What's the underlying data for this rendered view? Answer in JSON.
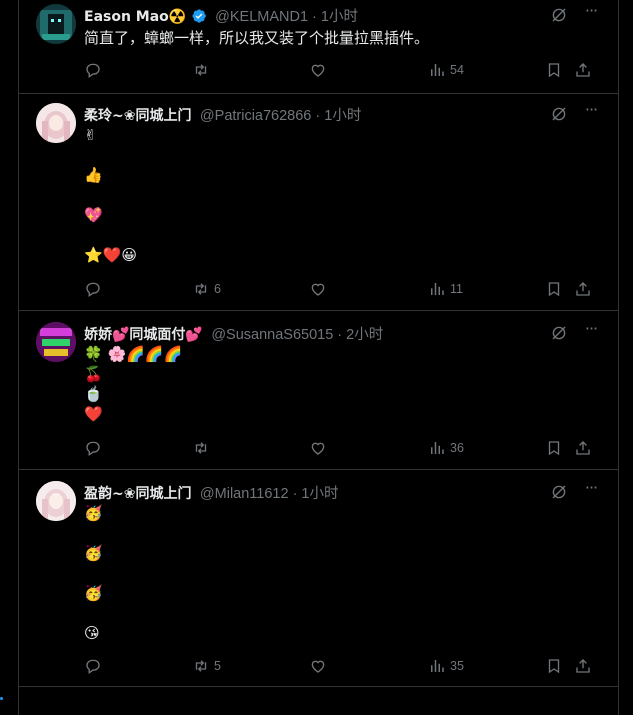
{
  "tweets": [
    {
      "name": "Eason Mao☢️",
      "handle": "@KELMAND1 · 1小时",
      "verified": true,
      "lines": [
        "简直了，蟑螂一样，所以我又装了个批量拉黑插件。"
      ],
      "reply": "",
      "retweet": "",
      "like": "",
      "views": "54"
    },
    {
      "name": "柔玲~❀同城上门",
      "handle": "@Patricia762866 · 1小时",
      "lines": [
        "✌",
        "👍",
        "💖",
        " ⭐❤️😀"
      ],
      "reply": "",
      "retweet": "6",
      "like": "",
      "views": "11"
    },
    {
      "name": "娇娇💕同城面付💕",
      "handle": "@SusannaS65015 · 2小时",
      "lines": [
        "🍀 🌸🌈🌈🌈",
        "🍒",
        "🍵",
        "❤️"
      ],
      "reply": "",
      "retweet": "",
      "like": "",
      "views": "36"
    },
    {
      "name": "盈韵~❀同城上门",
      "handle": "@Milan11612 · 1小时",
      "lines": [
        "🥳",
        "🥳",
        "🥳",
        " 😘"
      ],
      "reply": "",
      "retweet": "5",
      "like": "",
      "views": "35"
    }
  ],
  "colors": {
    "muted": "#71767b",
    "text": "#e7e9ea",
    "border": "#2f3336",
    "accent": "#1d9bf0"
  },
  "icons": [
    "reply-icon",
    "retweet-icon",
    "like-icon",
    "views-icon",
    "bookmark-icon",
    "share-icon",
    "grok-icon",
    "more-icon"
  ]
}
